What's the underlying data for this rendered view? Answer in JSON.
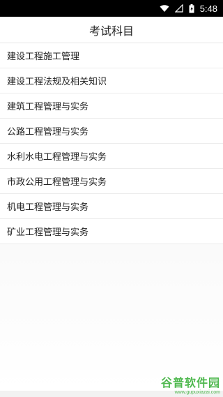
{
  "status_bar": {
    "time": "5:48",
    "icons": [
      "wifi-icon",
      "signal-icon",
      "battery-icon"
    ]
  },
  "header": {
    "title": "考试科目"
  },
  "subjects": [
    {
      "label": "建设工程施工管理"
    },
    {
      "label": "建设工程法规及相关知识"
    },
    {
      "label": "建筑工程管理与实务"
    },
    {
      "label": "公路工程管理与实务"
    },
    {
      "label": "水利水电工程管理与实务"
    },
    {
      "label": "市政公用工程管理与实务"
    },
    {
      "label": "机电工程管理与实务"
    },
    {
      "label": "矿业工程管理与实务"
    }
  ],
  "watermark": {
    "brand": "谷普软件园",
    "url": "www.gupuxiazai.com"
  }
}
